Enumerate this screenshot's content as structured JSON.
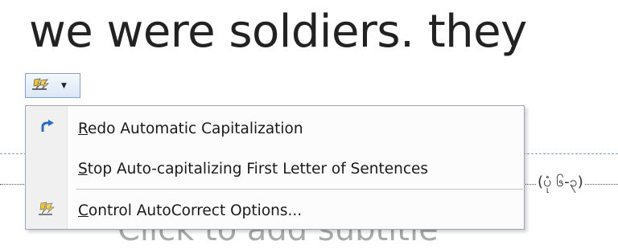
{
  "document": {
    "heading_text": "we were soldiers. they",
    "placeholder_text": "Click to add subtitle",
    "side_text": "(ပုံ ၆-၃)"
  },
  "autocorrect_button": {
    "icon": "autocorrect-lightning-icon",
    "dropdown_icon": "chevron-down-icon"
  },
  "menu": {
    "items": [
      {
        "accelerator": "R",
        "rest": "edo Automatic Capitalization",
        "icon": "redo-arrow-icon"
      },
      {
        "accelerator": "S",
        "rest": "top Auto-capitalizing First Letter of Sentences",
        "icon": ""
      },
      {
        "accelerator": "C",
        "rest": "ontrol AutoCorrect Options...",
        "icon": "autocorrect-lightning-icon"
      }
    ]
  },
  "colors": {
    "button_border": "#86a0c8",
    "menu_border": "#9aa6b8",
    "gutter": "#f0f0f0",
    "redo_arrow": "#2b6cc4",
    "lightning_yellow": "#f4c430"
  }
}
